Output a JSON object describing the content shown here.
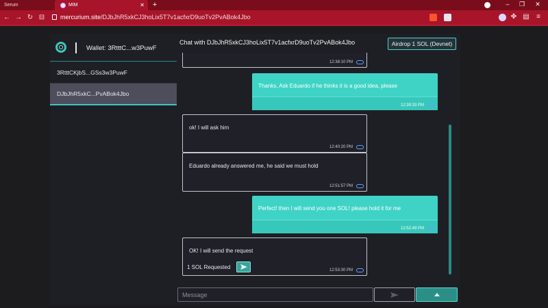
{
  "browser": {
    "tabs": [
      {
        "title": "Serum",
        "active": false
      },
      {
        "title": "MIM",
        "active": true
      }
    ],
    "url_host": "mercurium.site",
    "url_path": "/DJbJhR5xkCJ3hoLix5T7v1acfxrD9uoTv2PvABok4Jbo"
  },
  "app": {
    "wallet_label": "Wallet: 3RtttC...w3PuwF",
    "contacts": [
      {
        "label": "3RtttCKjbS...GSs3w3PuwF",
        "selected": false
      },
      {
        "label": "DJbJhR5xkC...PvABok4Jbo",
        "selected": true
      }
    ],
    "chat_title": "Chat with DJbJhR5xkCJ3hoLix5T7v1acfxrD9uoTv2PvABok4Jbo",
    "airdrop_label": "Airdrop 1 SOL (Devnet)",
    "messages": [
      {
        "type": "received",
        "text": "",
        "time": "12:38:10 PM"
      },
      {
        "type": "sent",
        "text": "Thanks, Ask Eduardo if he thinks it is a good idea, please",
        "time": "12:39:33 PM"
      },
      {
        "type": "received",
        "text": "ok! I will ask him",
        "time": "12:40:20 PM"
      },
      {
        "type": "received",
        "text": "Eduardo already answered me, he said we must hold",
        "time": "12:51:57 PM"
      },
      {
        "type": "sent",
        "text": "Perfect! then I will send you one SOL! please hold it for me",
        "time": "12:52:49 PM"
      },
      {
        "type": "received",
        "text": "OK! I will send the request",
        "time": "12:53:30 PM",
        "request": "1 SOL Requested"
      }
    ],
    "composer": {
      "placeholder": "Message"
    }
  },
  "colors": {
    "accent": "#3fd3c6",
    "browser_chrome": "#a8152a",
    "background": "#1e1f25"
  }
}
